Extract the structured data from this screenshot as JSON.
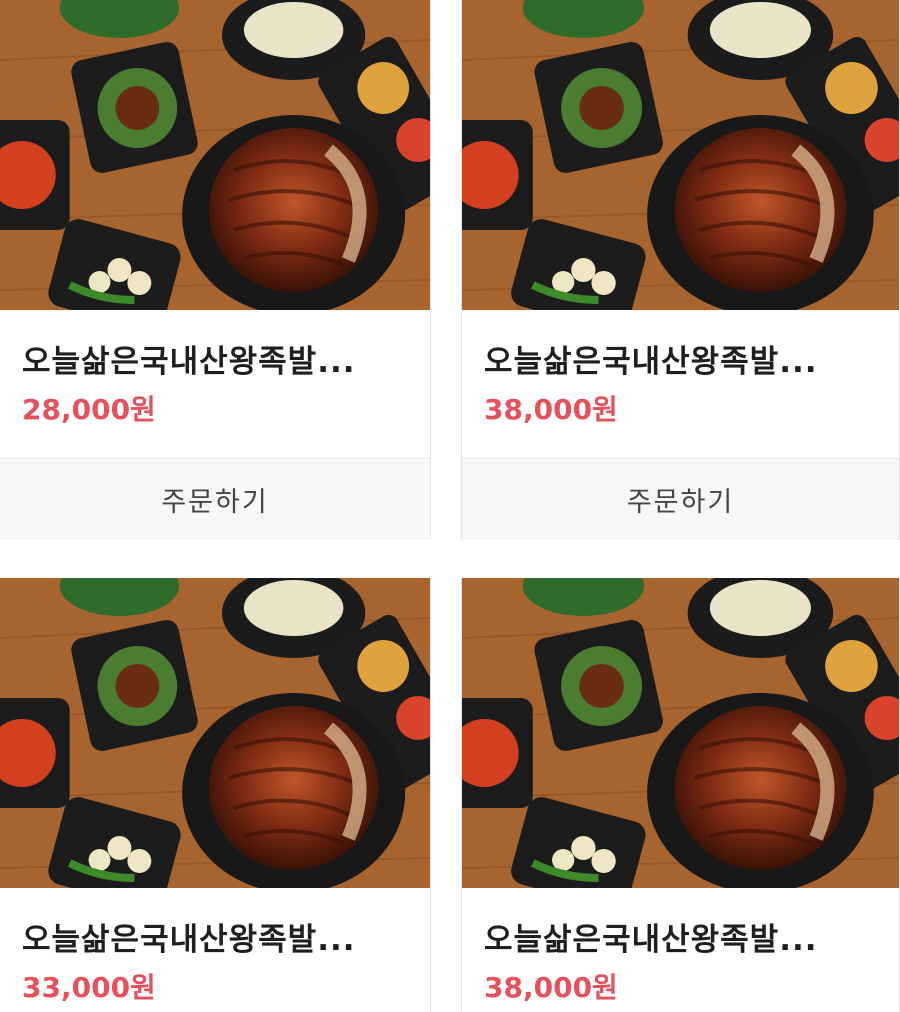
{
  "products": [
    {
      "name": "오늘삶은국내산왕족발...",
      "price": "28,000원",
      "order_label": "주문하기"
    },
    {
      "name": "오늘삶은국내산왕족발...",
      "price": "38,000원",
      "order_label": "주문하기"
    },
    {
      "name": "오늘삶은국내산왕족발...",
      "price": "33,000원"
    },
    {
      "name": "오늘삶은국내산왕족발...",
      "price": "38,000원"
    }
  ],
  "colors": {
    "price": "#e8505b",
    "button_bg": "#f6f7f9",
    "title": "#1f1f1f"
  }
}
